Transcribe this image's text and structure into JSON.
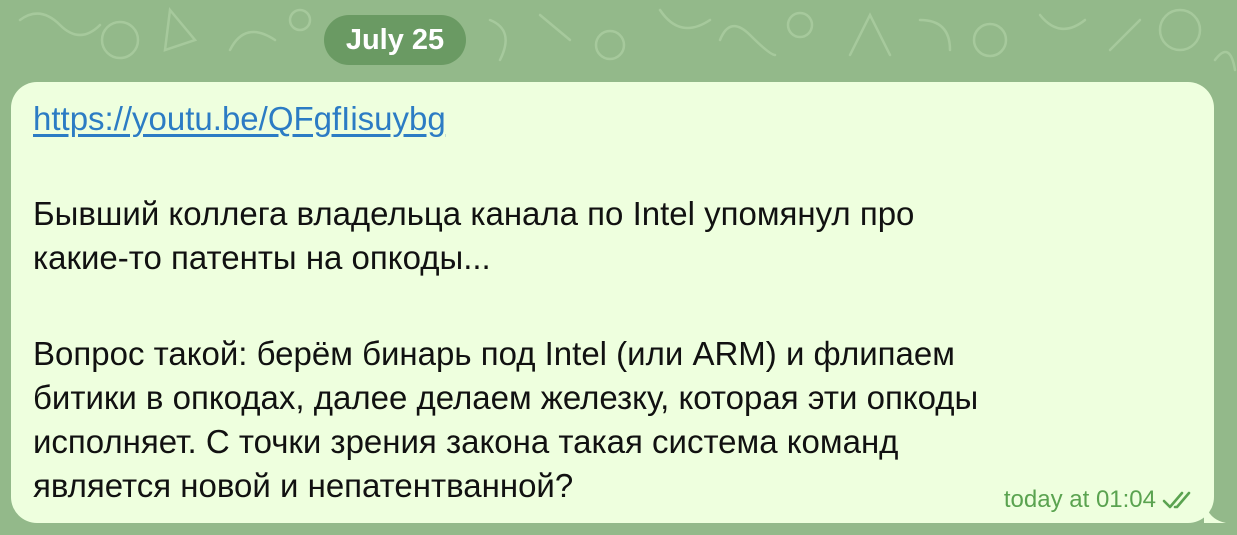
{
  "date_separator": "July 25",
  "message": {
    "link": "https://youtu.be/QFgfIisuybg",
    "paragraph_1_line_1": "Бывший коллега владельца канала по Intel упомянул про",
    "paragraph_1_line_2": "какие-то патенты на опкоды...",
    "paragraph_2_line_1": "Вопрос такой: берём бинарь под Intel (или ARM) и флипаем",
    "paragraph_2_line_2": "битики в опкодах, далее делаем железку, которая эти опкоды",
    "paragraph_2_line_3": "исполняет. С точки зрения закона такая система команд",
    "paragraph_2_line_4": "является новой и непатентванной?",
    "timestamp": "today at 01:04",
    "status_icon": "double-check-icon"
  },
  "colors": {
    "background": "#93b98a",
    "bubble": "#eeffde",
    "link": "#2c7cc4",
    "meta": "#5aa350",
    "date_pill": "#6a9a63"
  }
}
